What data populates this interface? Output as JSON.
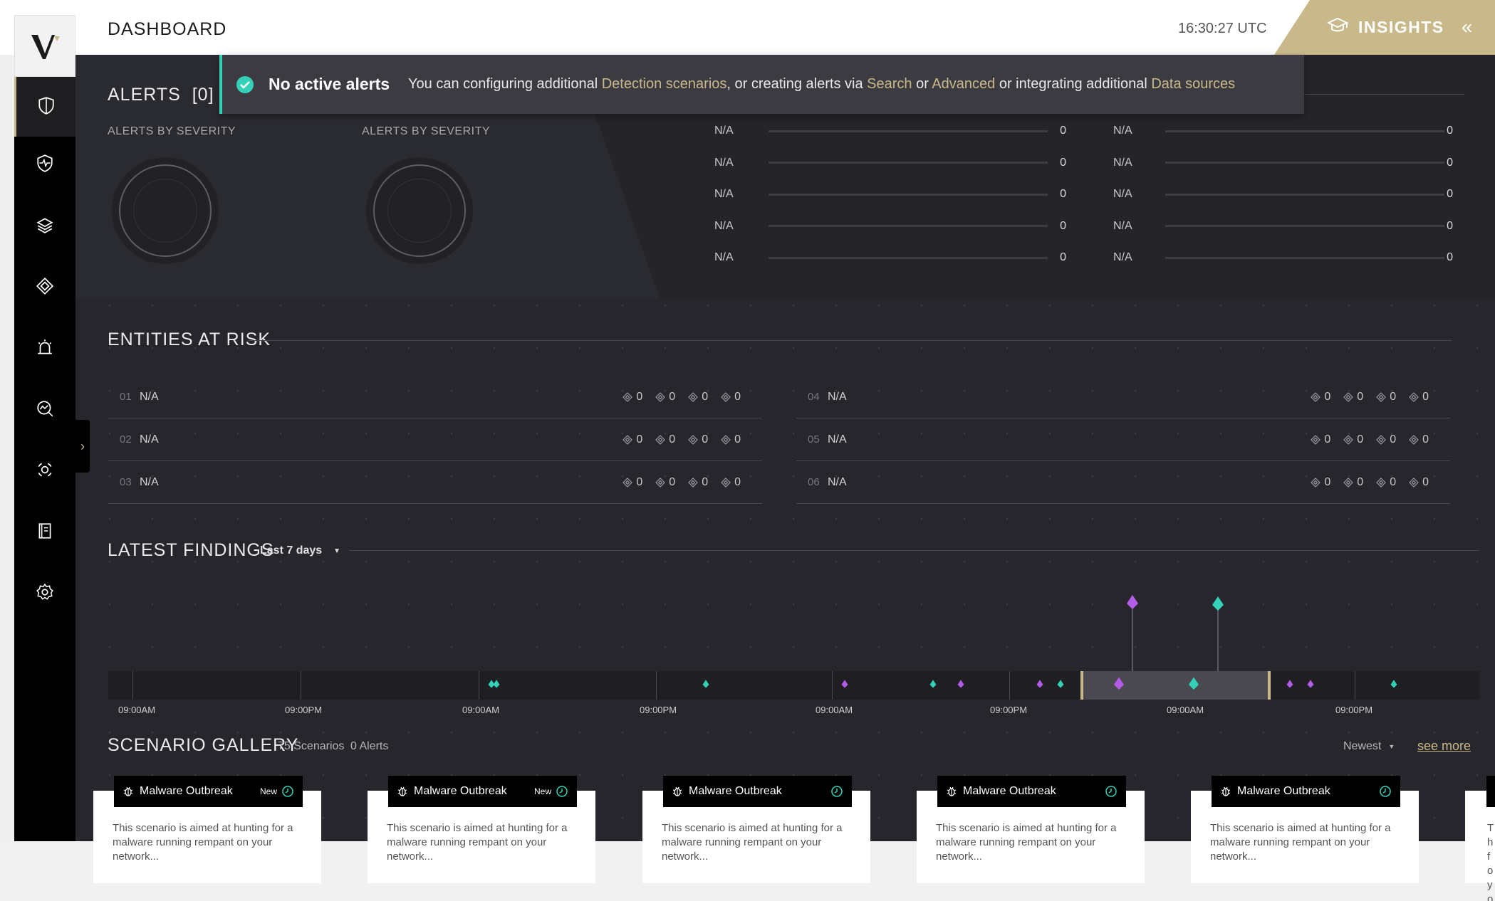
{
  "header": {
    "title": "DASHBOARD",
    "time": "16:30:27 UTC",
    "insights_label": "INSIGHTS"
  },
  "banner": {
    "strong": "No active alerts",
    "t1": "You can configuring additional ",
    "l1": "Detection scenarios",
    "t2": ", or creating alerts via ",
    "l2": "Search",
    "t3": " or ",
    "l3": "Advanced",
    "t4": " or integrating additional ",
    "l4": "Data sources"
  },
  "alerts": {
    "title": "ALERTS",
    "count": "[0]",
    "severity_label_1": "ALERTS BY SEVERITY",
    "severity_label_2": "ALERTS BY SEVERITY",
    "left_rows": [
      {
        "label": "N/A",
        "value": "0"
      },
      {
        "label": "N/A",
        "value": "0"
      },
      {
        "label": "N/A",
        "value": "0"
      },
      {
        "label": "N/A",
        "value": "0"
      },
      {
        "label": "N/A",
        "value": "0"
      }
    ],
    "right_rows": [
      {
        "label": "N/A",
        "value": "0"
      },
      {
        "label": "N/A",
        "value": "0"
      },
      {
        "label": "N/A",
        "value": "0"
      },
      {
        "label": "N/A",
        "value": "0"
      },
      {
        "label": "N/A",
        "value": "0"
      }
    ]
  },
  "entities": {
    "title": "ENTITIES AT RISK",
    "left": [
      {
        "idx": "01",
        "name": "N/A",
        "m": [
          "0",
          "0",
          "0",
          "0"
        ]
      },
      {
        "idx": "02",
        "name": "N/A",
        "m": [
          "0",
          "0",
          "0",
          "0"
        ]
      },
      {
        "idx": "03",
        "name": "N/A",
        "m": [
          "0",
          "0",
          "0",
          "0"
        ]
      }
    ],
    "right": [
      {
        "idx": "04",
        "name": "N/A",
        "m": [
          "0",
          "0",
          "0",
          "0"
        ]
      },
      {
        "idx": "05",
        "name": "N/A",
        "m": [
          "0",
          "0",
          "0",
          "0"
        ]
      },
      {
        "idx": "06",
        "name": "N/A",
        "m": [
          "0",
          "0",
          "0",
          "0"
        ]
      }
    ]
  },
  "findings": {
    "title": "LATEST FINDINGS",
    "range": "Last 7 days",
    "ticks": [
      "09:00AM",
      "09:00PM",
      "09:00AM",
      "09:00PM",
      "09:00AM",
      "09:00PM",
      "09:00AM",
      "09:00PM"
    ],
    "colors": {
      "purple": "#b35ce8",
      "teal": "#33d1b8",
      "accent": "#c9b98a"
    }
  },
  "gallery": {
    "title": "SCENARIO GALLERY",
    "scenarios": "75 Scenarios",
    "alerts": "0 Alerts",
    "sort": "Newest",
    "see_more": "see more",
    "cards": [
      {
        "title": "Malware Outbreak",
        "badge": "New",
        "text": "This scenario is aimed at hunting for a  malware running rempant on your network..."
      },
      {
        "title": "Malware Outbreak",
        "badge": "New",
        "text": "This scenario is aimed at hunting for a  malware running rempant on your network..."
      },
      {
        "title": "Malware Outbreak",
        "badge": "",
        "text": "This scenario is aimed at hunting for a  malware running rempant on your network..."
      },
      {
        "title": "Malware Outbreak",
        "badge": "",
        "text": "This scenario is aimed at hunting for a  malware running rempant on your network..."
      },
      {
        "title": "Malware Outbreak",
        "badge": "",
        "text": "This scenario is aimed at hunting for a  malware running rempant on your network..."
      }
    ],
    "partial_card_text": "Th fo yo"
  },
  "sidebar": {
    "items": [
      "shield-icon",
      "heart-shield-icon",
      "layers-icon",
      "diamond-icon",
      "alarm-icon",
      "search-chart-icon",
      "radar-icon",
      "notebook-icon",
      "gear-icon"
    ]
  }
}
